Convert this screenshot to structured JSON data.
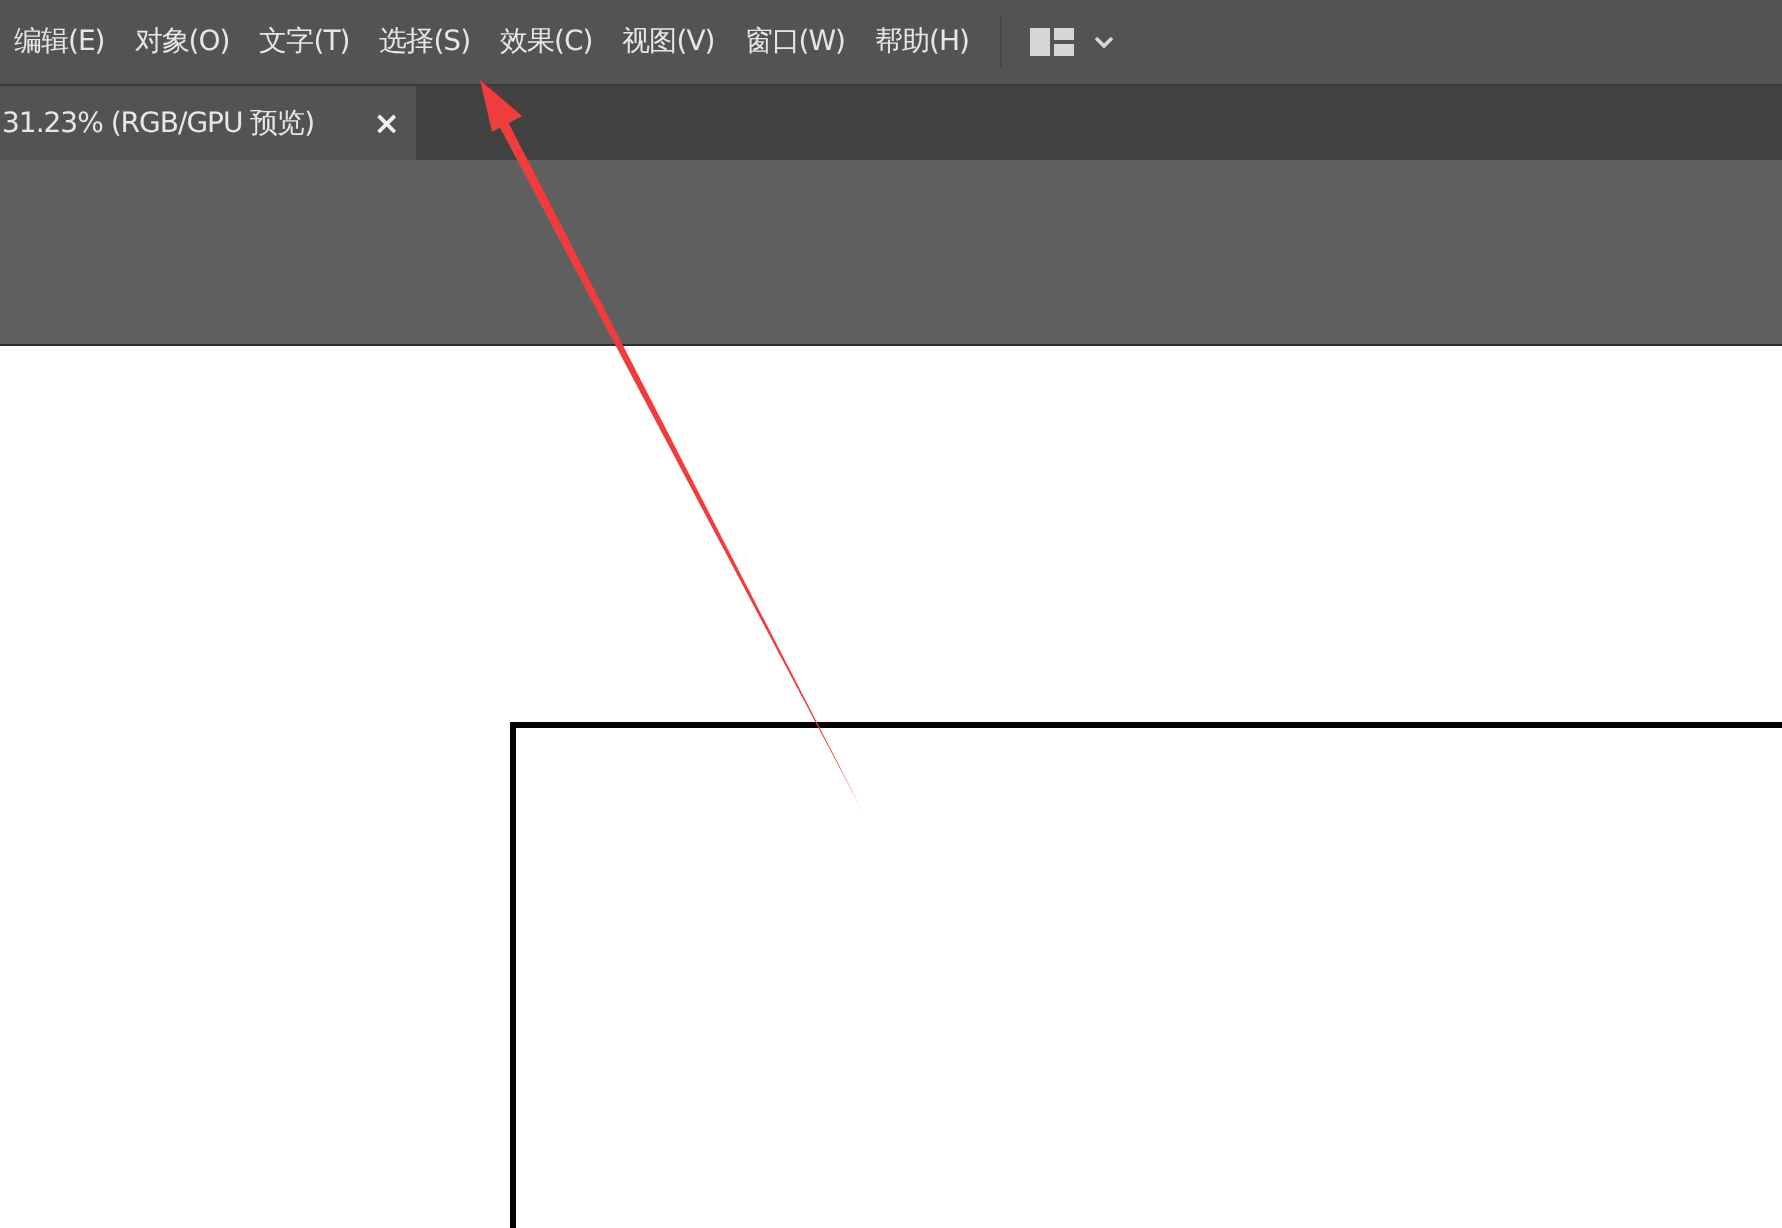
{
  "menu_bar": {
    "items": [
      {
        "label": "编辑(E)"
      },
      {
        "label": "对象(O)"
      },
      {
        "label": "文字(T)"
      },
      {
        "label": "选择(S)"
      },
      {
        "label": "效果(C)"
      },
      {
        "label": "视图(V)"
      },
      {
        "label": "窗口(W)"
      },
      {
        "label": "帮助(H)"
      }
    ]
  },
  "tabs": [
    {
      "label": "31.23% (RGB/GPU 预览)",
      "close": "×"
    }
  ]
}
